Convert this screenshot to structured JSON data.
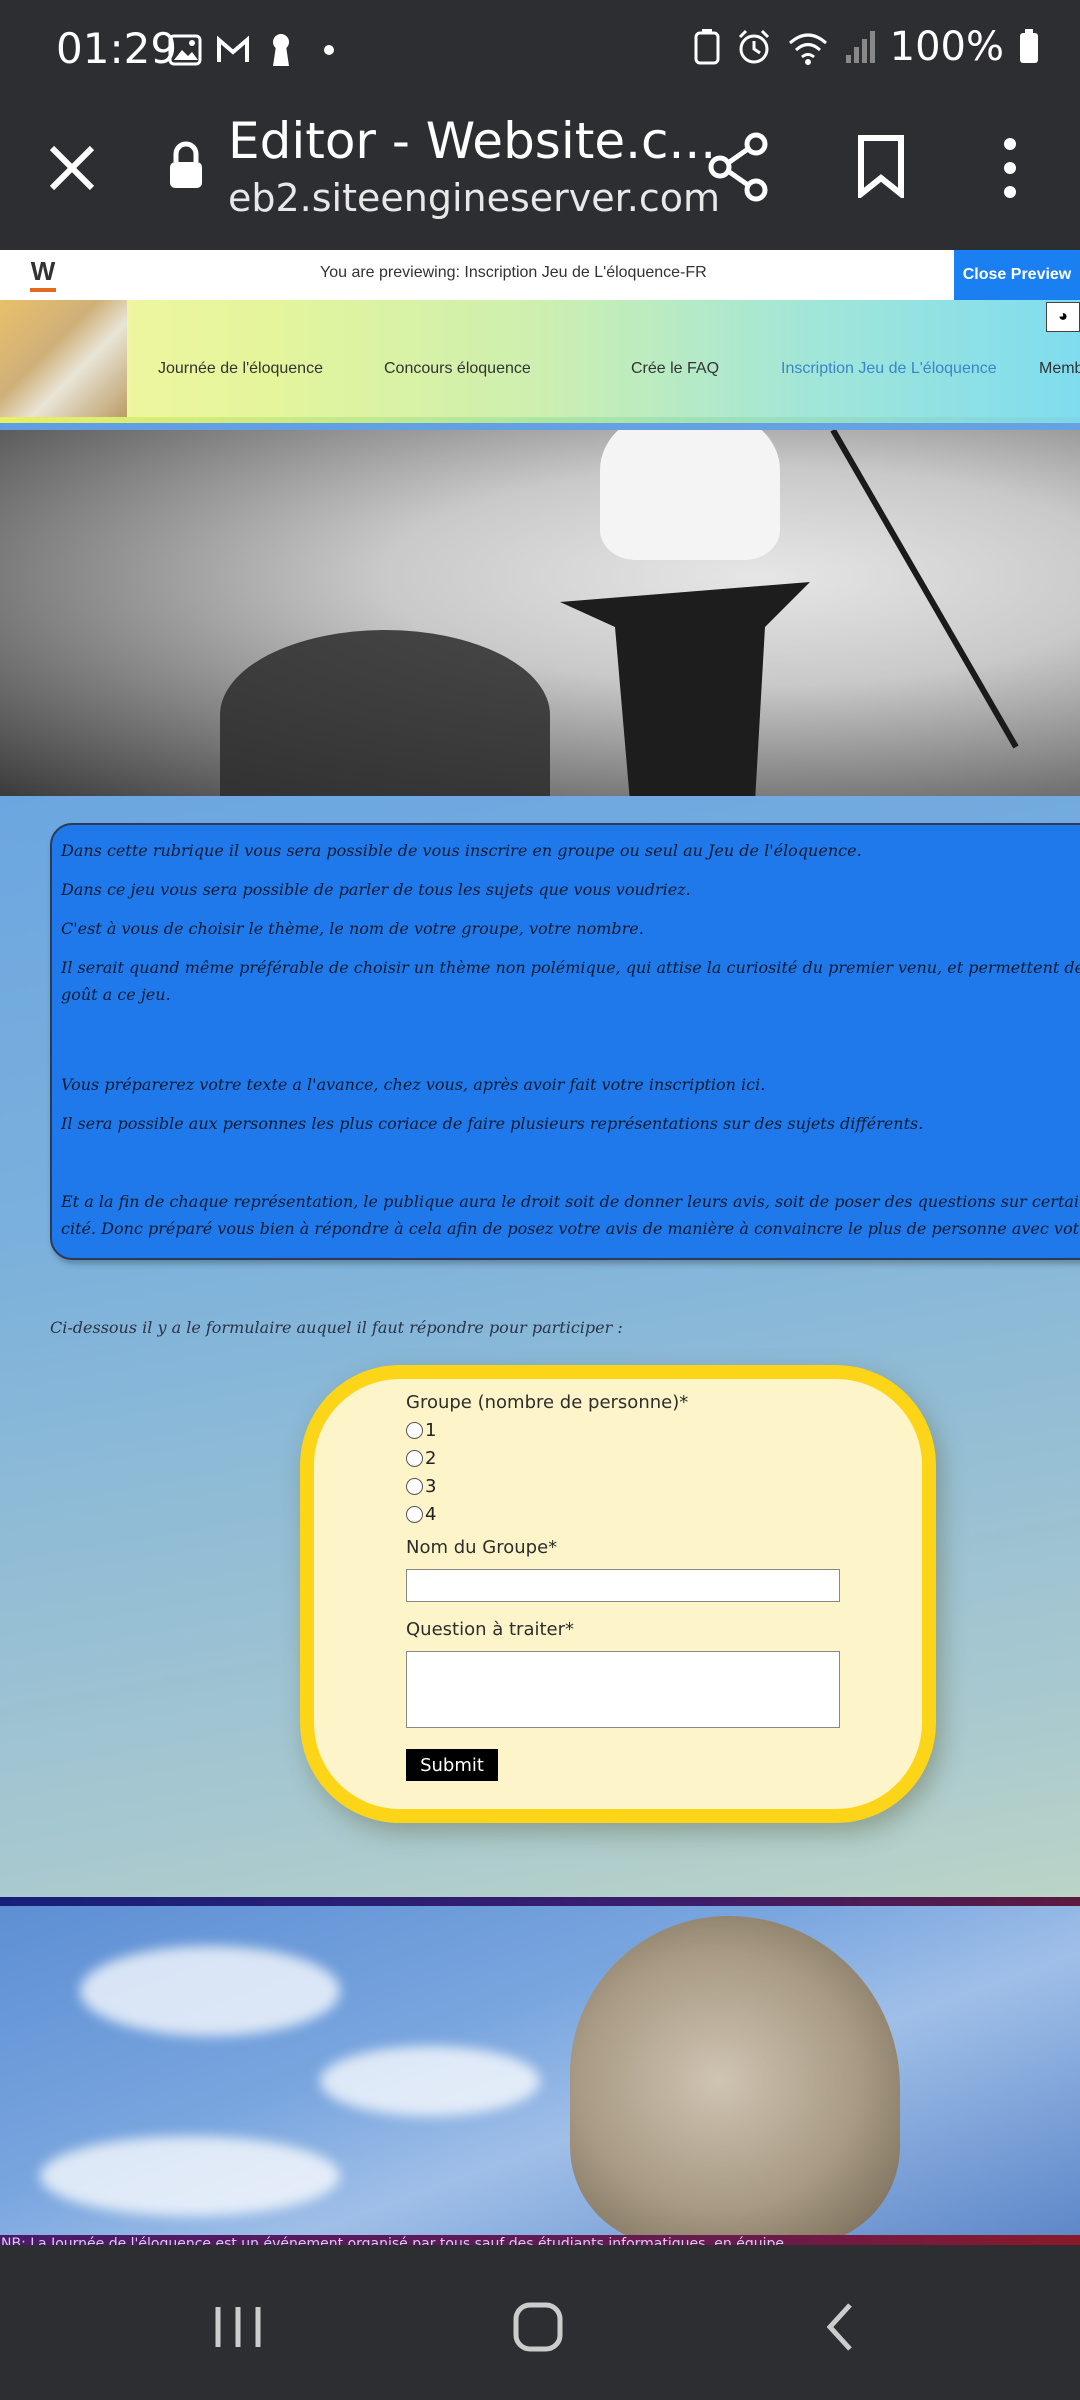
{
  "status_bar": {
    "time": "01:29",
    "battery": "100%"
  },
  "browser": {
    "title": "Editor - Website.c...",
    "url": "eb2.siteengineserver.com"
  },
  "preview_bar": {
    "logo": "W",
    "message": "You are previewing: Inscription Jeu de L'éloquence-FR",
    "close_label": "Close Preview"
  },
  "nav": {
    "items": [
      {
        "label": "Journée de l'éloquence"
      },
      {
        "label": "Concours éloquence"
      },
      {
        "label": "Crée le FAQ"
      },
      {
        "label": "Inscription Jeu de L'éloquence"
      },
      {
        "label": "Memb"
      }
    ],
    "active_index": 3
  },
  "info": {
    "paragraphs": [
      "Dans cette rubrique il vous sera possible de vous inscrire en groupe ou seul au Jeu de l'éloquence.",
      "Dans ce jeu vous sera possible de parler de tous les sujets que vous voudriez.",
      "C'est à vous de choisir le thème, le nom de votre groupe, votre nombre.",
      "Il serait quand même préférable de choisir un thème non polémique, qui attise la curiosité du premier venu, et permettent de donner goût a l'éloqu",
      "goût a ce jeu.",
      "Vous préparerez votre texte a l'avance, chez vous, après avoir fait votre inscription ici.",
      "Il sera possible aux personnes les plus coriace de faire plusieurs représentations sur des sujets différents.",
      "Et a la fin de chaque représentation, le publique aura le droit soit de donner leurs avis, soit de poser des questions sur certains éléments que v",
      "cité. Donc préparé vous bien à répondre à cela afin de posez votre avis de manière à convaincre le plus de personne avec votre opinion et vos exemp"
    ]
  },
  "below_text": "Ci-dessous il y a le formulaire auquel il faut répondre pour participer :",
  "form": {
    "group_label": "Groupe (nombre de personne)*",
    "options": [
      "1",
      "2",
      "3",
      "4"
    ],
    "name_label": "Nom du Groupe*",
    "name_value": "",
    "question_label": "Question à traiter*",
    "question_value": "",
    "submit_label": "Submit"
  },
  "footer_note": "NB: La Journée de l'éloquence est un événement organisé par tous sauf des étudiants informatiques, en équipe.",
  "colors": {
    "accent_blue": "#1a7ff0",
    "info_box": "#1f79ea",
    "form_border": "#fdd518",
    "form_bg": "#fdf5c9"
  }
}
